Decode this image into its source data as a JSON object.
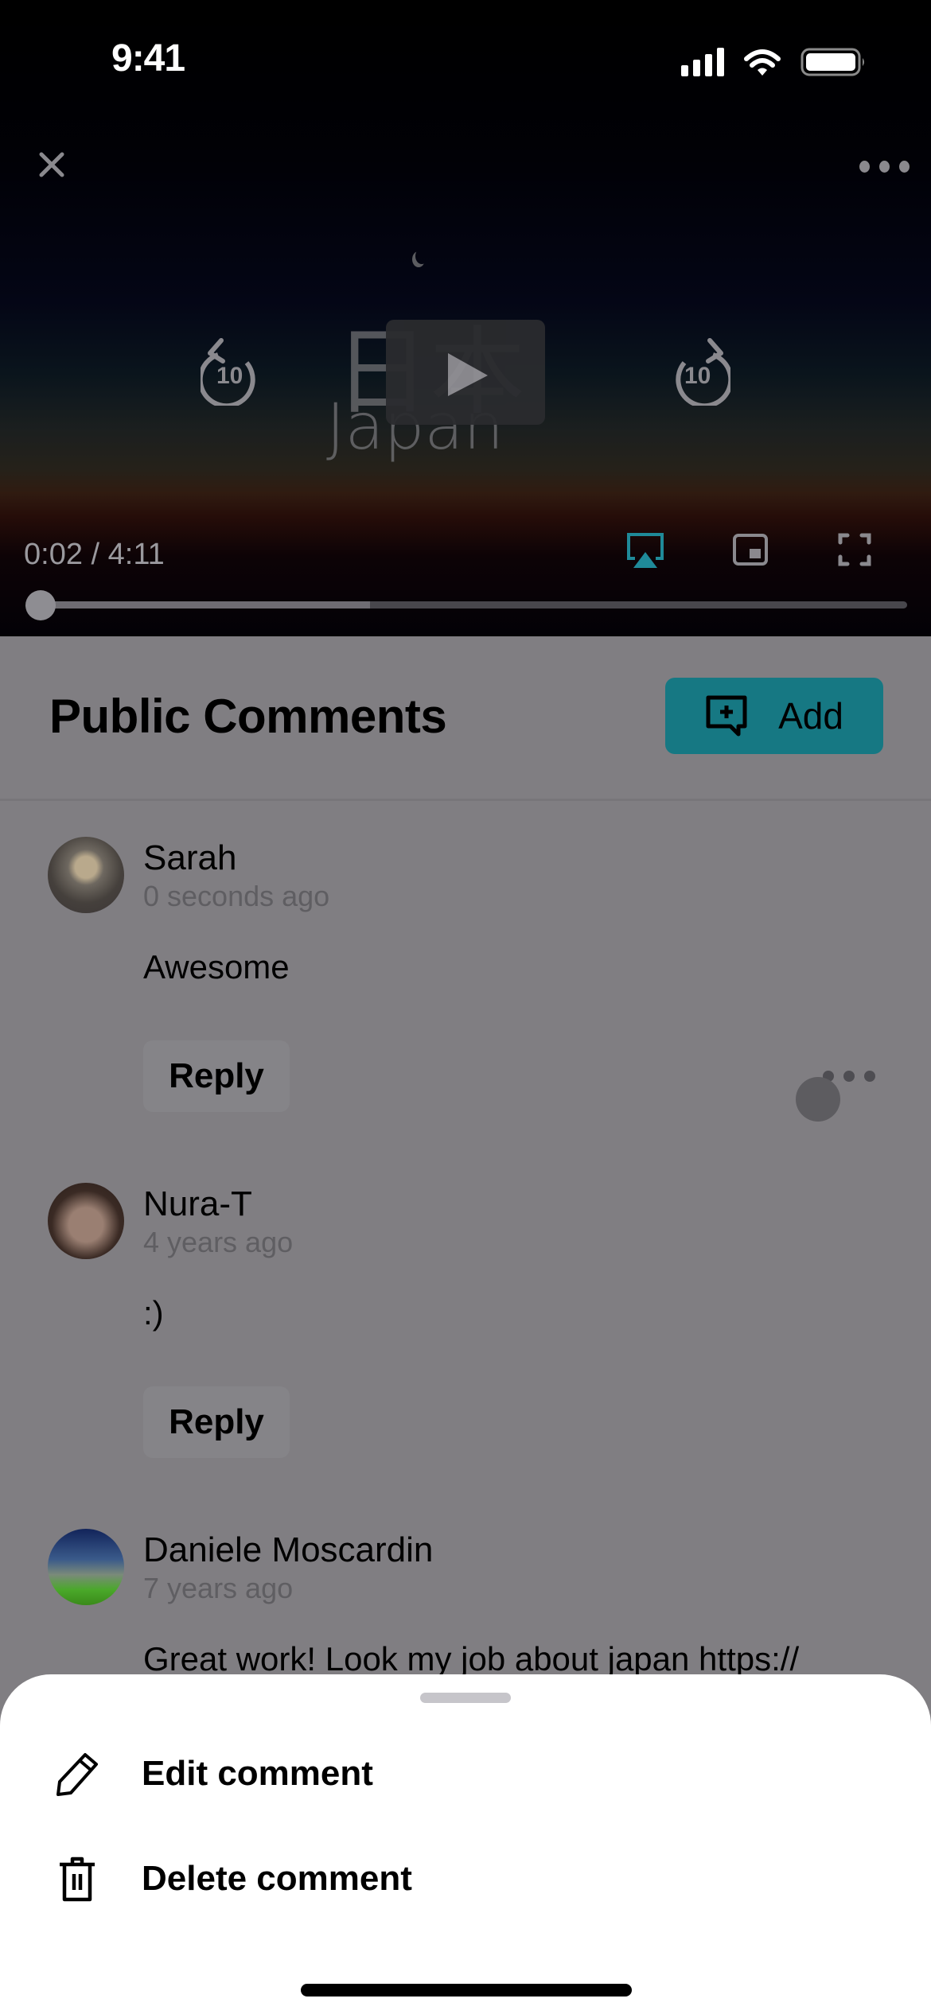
{
  "status_bar": {
    "time": "9:41"
  },
  "video": {
    "title_art_kanji": "日本",
    "title_art_text": "Japan",
    "current_time": "0:02",
    "duration": "4:11",
    "time_readout": "0:02 / 4:11",
    "skip_back_seconds": "10",
    "skip_forward_seconds": "10",
    "playback_progress": 0.008,
    "buffered_progress": 0.385,
    "accent_color": "#1f8a99",
    "icons": [
      "close-icon",
      "more-icon",
      "skip-back-10-icon",
      "play-icon",
      "skip-forward-10-icon",
      "airplay-icon",
      "picture-in-picture-icon",
      "fullscreen-icon"
    ]
  },
  "comments_header": {
    "title": "Public Comments",
    "add_label": "Add",
    "add_color": "#167883"
  },
  "comments": [
    {
      "author": "Sarah",
      "time": "0 seconds ago",
      "text": "Awesome",
      "reply_label": "Reply",
      "has_more_menu": true
    },
    {
      "author": "Nura-T",
      "time": "4 years ago",
      "text": ":)",
      "reply_label": "Reply"
    },
    {
      "author": "Daniele Moscardin",
      "time": "7 years ago",
      "text": "Great work! Look my job about japan https://"
    }
  ],
  "action_sheet": {
    "items": [
      {
        "label": "Edit comment",
        "icon": "pencil-icon"
      },
      {
        "label": "Delete comment",
        "icon": "trash-icon"
      }
    ]
  }
}
